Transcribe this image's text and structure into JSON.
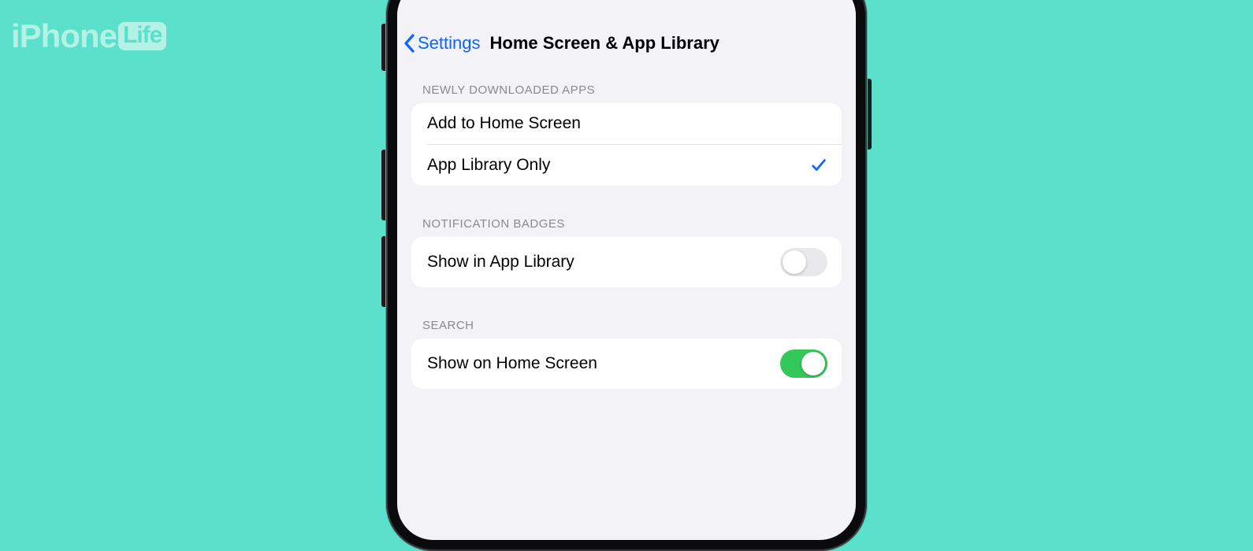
{
  "watermark": {
    "brand_prefix": "iPhone",
    "brand_badge": "Life"
  },
  "nav": {
    "back_label": "Settings",
    "title": "Home Screen & App Library"
  },
  "sections": {
    "newly_downloaded": {
      "header": "NEWLY DOWNLOADED APPS",
      "options": {
        "add_home": {
          "label": "Add to Home Screen",
          "selected": false
        },
        "app_library_only": {
          "label": "App Library Only",
          "selected": true
        }
      }
    },
    "notification_badges": {
      "header": "NOTIFICATION BADGES",
      "show_in_app_library": {
        "label": "Show in App Library",
        "on": false
      }
    },
    "search": {
      "header": "SEARCH",
      "show_on_home": {
        "label": "Show on Home Screen",
        "on": true
      }
    }
  },
  "colors": {
    "accent": "#0a66ff",
    "toggle_on": "#34c759",
    "bg_teal": "#5ae0cb"
  }
}
